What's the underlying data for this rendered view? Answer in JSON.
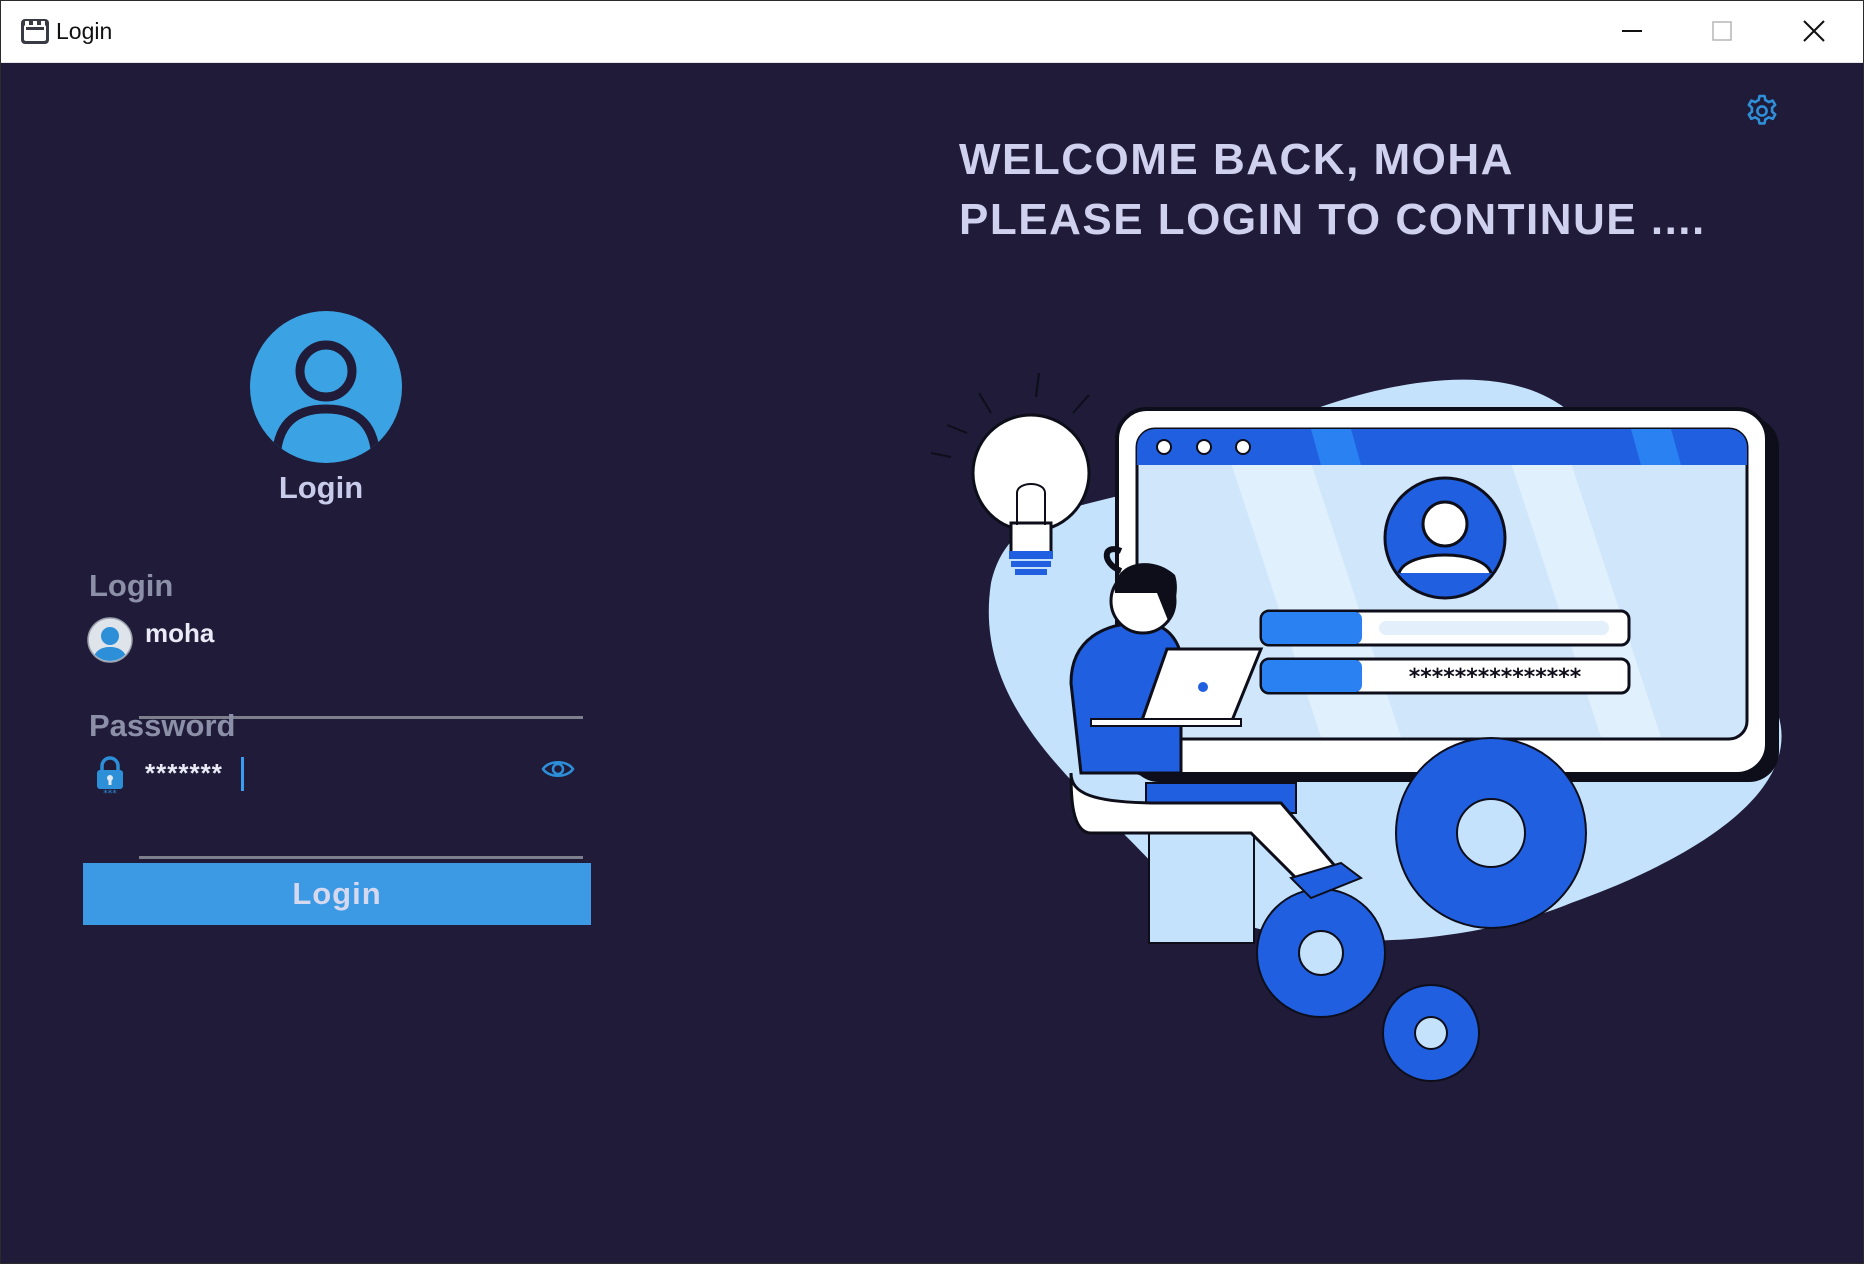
{
  "window": {
    "title": "Login"
  },
  "header": {
    "welcome_line1": "WELCOME BACK, MOHA",
    "welcome_line2": "PLEASE LOGIN TO CONTINUE ...."
  },
  "avatar": {
    "caption": "Login"
  },
  "form": {
    "login_label": "Login",
    "login_value": "moha",
    "password_label": "Password",
    "password_value": "*******",
    "submit_label": "Login"
  },
  "illustration": {
    "password_mask": "***************"
  },
  "colors": {
    "background": "#1f1b38",
    "accent": "#3b9ae3",
    "text": "#cfd1ee",
    "label": "#8c8fa8"
  },
  "icons": [
    "app-icon",
    "minimize-icon",
    "maximize-icon",
    "close-icon",
    "settings-gear-icon",
    "user-avatar-icon",
    "user-icon",
    "lock-icon",
    "eye-icon"
  ]
}
